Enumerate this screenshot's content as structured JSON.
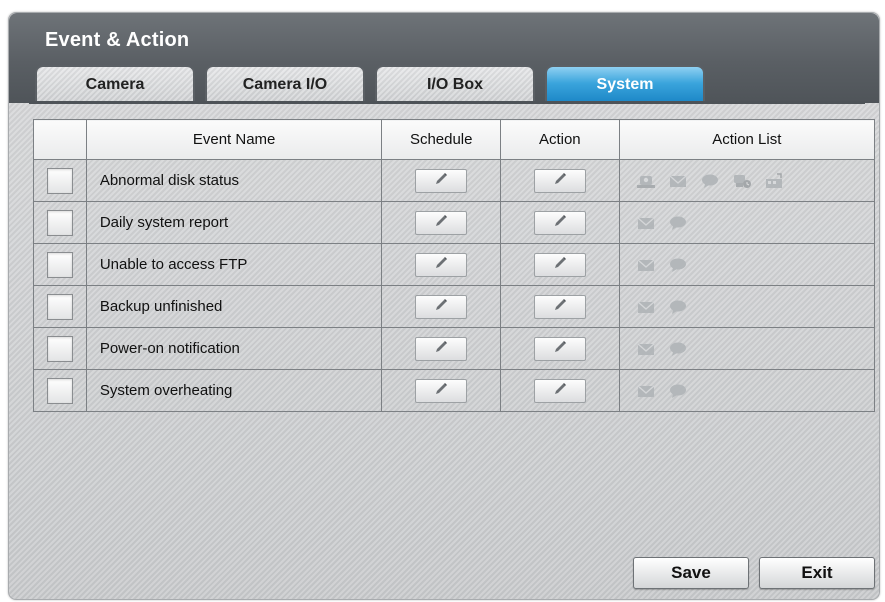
{
  "window": {
    "title": "Event & Action"
  },
  "tabs": [
    {
      "label": "Camera",
      "active": false
    },
    {
      "label": "Camera I/O",
      "active": false
    },
    {
      "label": "I/O Box",
      "active": false
    },
    {
      "label": "System",
      "active": true
    }
  ],
  "table": {
    "headers": {
      "select": "",
      "event_name": "Event Name",
      "schedule": "Schedule",
      "action": "Action",
      "action_list": "Action List"
    },
    "rows": [
      {
        "name": "Abnormal disk status",
        "checked": false,
        "actions": [
          "alarm-light-icon",
          "email-icon",
          "message-icon",
          "record-camera-icon",
          "io-output-icon"
        ]
      },
      {
        "name": "Daily system report",
        "checked": false,
        "actions": [
          "email-icon",
          "message-icon"
        ]
      },
      {
        "name": "Unable to access FTP",
        "checked": false,
        "actions": [
          "email-icon",
          "message-icon"
        ]
      },
      {
        "name": "Backup unfinished",
        "checked": false,
        "actions": [
          "email-icon",
          "message-icon"
        ]
      },
      {
        "name": "Power-on notification",
        "checked": false,
        "actions": [
          "email-icon",
          "message-icon"
        ]
      },
      {
        "name": "System overheating",
        "checked": false,
        "actions": [
          "email-icon",
          "message-icon"
        ]
      }
    ]
  },
  "buttons": {
    "save": "Save",
    "exit": "Exit"
  },
  "colors": {
    "active_tab": "#2b95d3",
    "title_bar": "#5a5f64",
    "icon_gray": "#aeb2b5"
  }
}
